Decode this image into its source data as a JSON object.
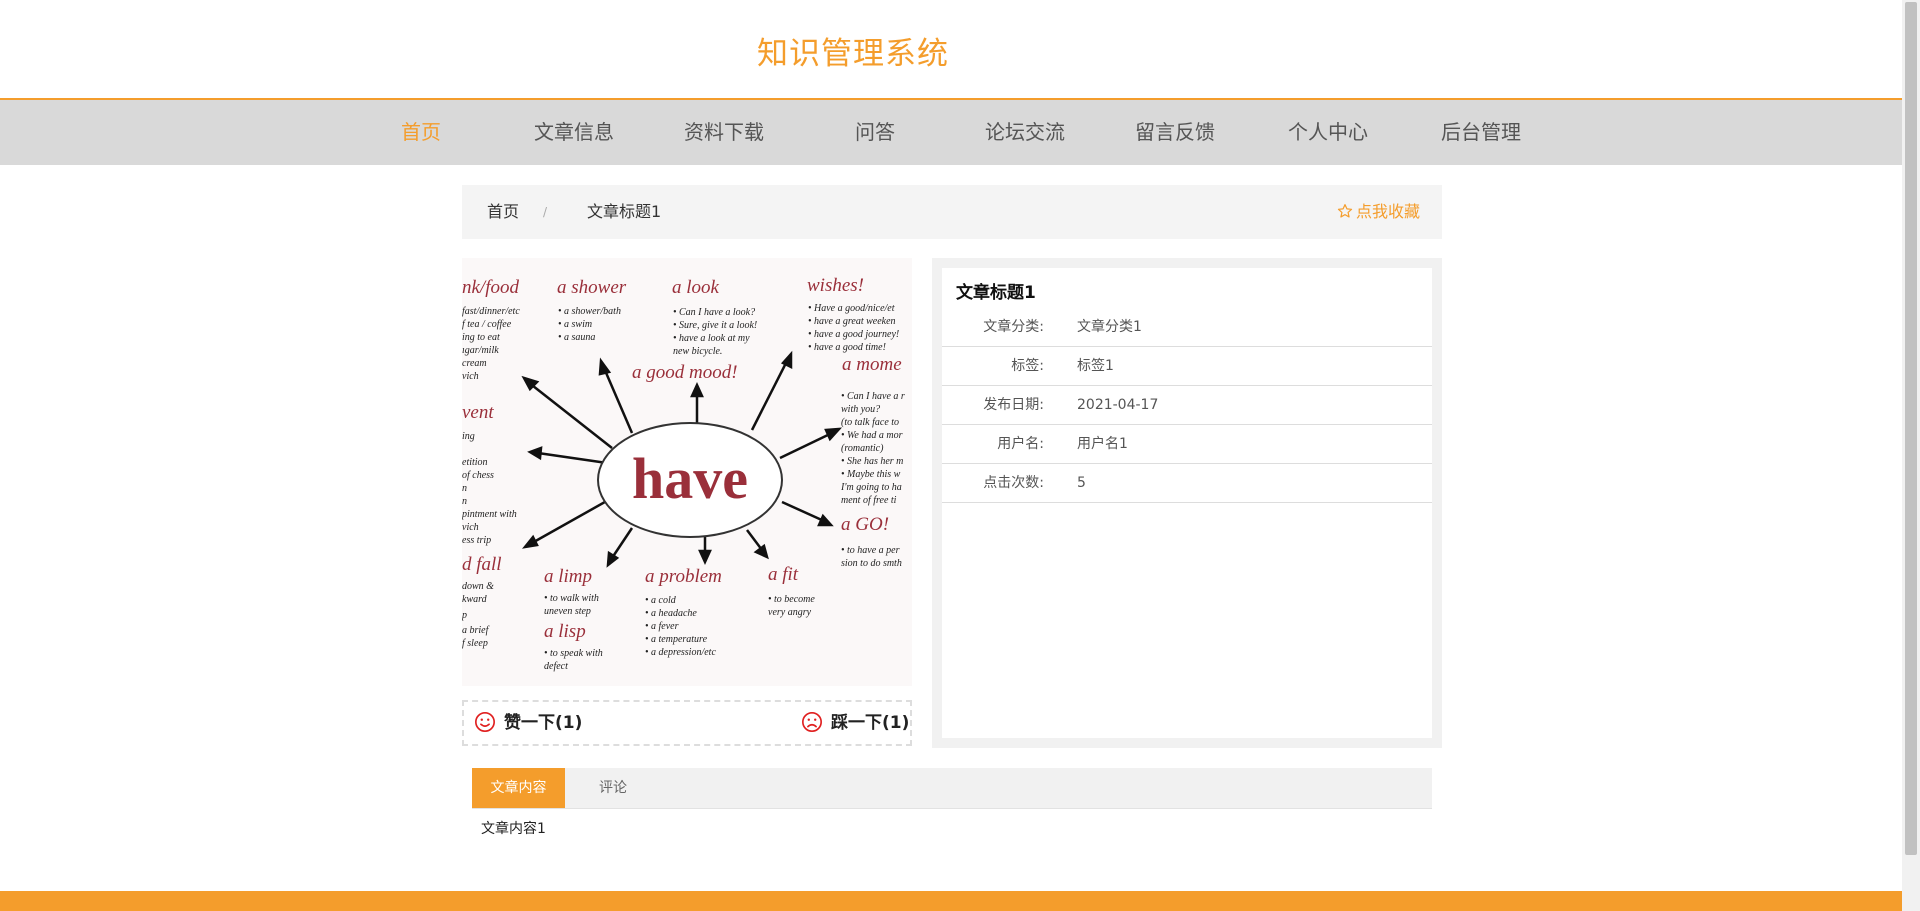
{
  "site": {
    "title": "知识管理系统"
  },
  "nav": {
    "items": [
      {
        "label": "首页",
        "active": true
      },
      {
        "label": "文章信息"
      },
      {
        "label": "资料下载"
      },
      {
        "label": "问答"
      },
      {
        "label": "论坛交流"
      },
      {
        "label": "留言反馈"
      },
      {
        "label": "个人中心"
      },
      {
        "label": "后台管理"
      }
    ]
  },
  "breadcrumb": {
    "home": "首页",
    "separator": "/",
    "current": "文章标题1",
    "favorite": "点我收藏",
    "favorite_icon": "star-outline-icon"
  },
  "image": {
    "center_word": "have",
    "phrases": {
      "top": [
        "nk/food",
        "a shower",
        "a look",
        "wishes!",
        "a good mood!",
        "a mome"
      ],
      "left": [
        "vent"
      ],
      "bottom": [
        "d fall",
        "a limp",
        "a problem",
        "a fit",
        "a lisp",
        "a GO!"
      ]
    },
    "notes": {
      "food": [
        "fast/dinner/etc",
        "f tea / coffee",
        "ing to eat",
        "ıgar/milk",
        "cream",
        "vich"
      ],
      "shower": [
        "• a shower/bath",
        "• a swim",
        "• a sauna"
      ],
      "look": [
        "• Can I have a look?",
        "• Sure, give it a look!",
        "• have a look at my",
        "new bicycle."
      ],
      "wishes": [
        "• Have a good/nice/et",
        "• have a great weeken",
        "• have a good journey!",
        "• have a good time!"
      ],
      "moment": [
        "• Can I have a r",
        "with you?",
        "(to talk face to",
        "• We had a mor",
        "(romantic)",
        "• She has her m",
        "• Maybe this w",
        "I'm going to ha",
        "ment of free ti"
      ],
      "event": [
        "ing",
        "",
        "etition",
        "of chess",
        "n",
        "n",
        "pintment with",
        "vich",
        "ess trip"
      ],
      "fall": [
        "down &",
        "kward",
        "p",
        "a brief",
        "f sleep"
      ],
      "limp": [
        "• to walk with",
        "uneven step"
      ],
      "lisp": [
        "• to speak with",
        "defect"
      ],
      "problem": [
        "• a cold",
        "• a headache",
        "• a fever",
        "• a temperature",
        "• a depression/etc"
      ],
      "fit": [
        "• to become",
        "very angry"
      ],
      "go": [
        "• to have a per",
        "sion to do smth"
      ]
    }
  },
  "votes": {
    "like": {
      "label": "赞一下(1)",
      "icon": "smile-icon"
    },
    "dislike": {
      "label": "踩一下(1)",
      "icon": "frown-icon"
    },
    "icon_color": "#e02020"
  },
  "article": {
    "title": "文章标题1",
    "fields": [
      {
        "label": "文章分类:",
        "value": "文章分类1"
      },
      {
        "label": "标签:",
        "value": "标签1"
      },
      {
        "label": "发布日期:",
        "value": "2021-04-17"
      },
      {
        "label": "用户名:",
        "value": "用户名1"
      },
      {
        "label": "点击次数:",
        "value": "5"
      }
    ]
  },
  "tabs": {
    "items": [
      {
        "label": "文章内容",
        "active": true
      },
      {
        "label": "评论"
      }
    ],
    "content": "文章内容1"
  },
  "theme": {
    "accent": "#f49d2c",
    "nav_bg": "#d9d9d9"
  }
}
